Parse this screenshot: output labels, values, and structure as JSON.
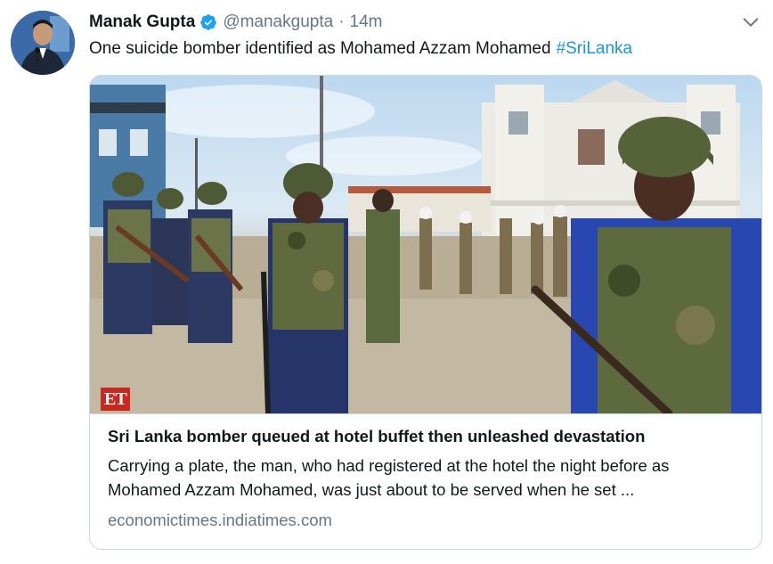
{
  "tweet": {
    "author_name": "Manak Gupta",
    "handle": "@manakgupta",
    "separator": "·",
    "time": "14m",
    "text": "One suicide bomber identified as Mohamed Azzam Mohamed",
    "hashtag": "#SriLanka",
    "verified_icon": "verified-badge-icon",
    "menu_icon": "chevron-down-icon"
  },
  "card": {
    "image_logo": "ET",
    "title": "Sri Lanka bomber queued at hotel buffet then unleashed devastation",
    "description": "Carrying a plate, the man, who had registered at the hotel the night before as Mohamed Azzam Mohamed, was just about to be served when he set ...",
    "domain": "economictimes.indiatimes.com"
  },
  "colors": {
    "link": "#1b95e0",
    "secondary_text": "#657786",
    "border": "#ccd6dd",
    "et_red": "#c8281e"
  }
}
